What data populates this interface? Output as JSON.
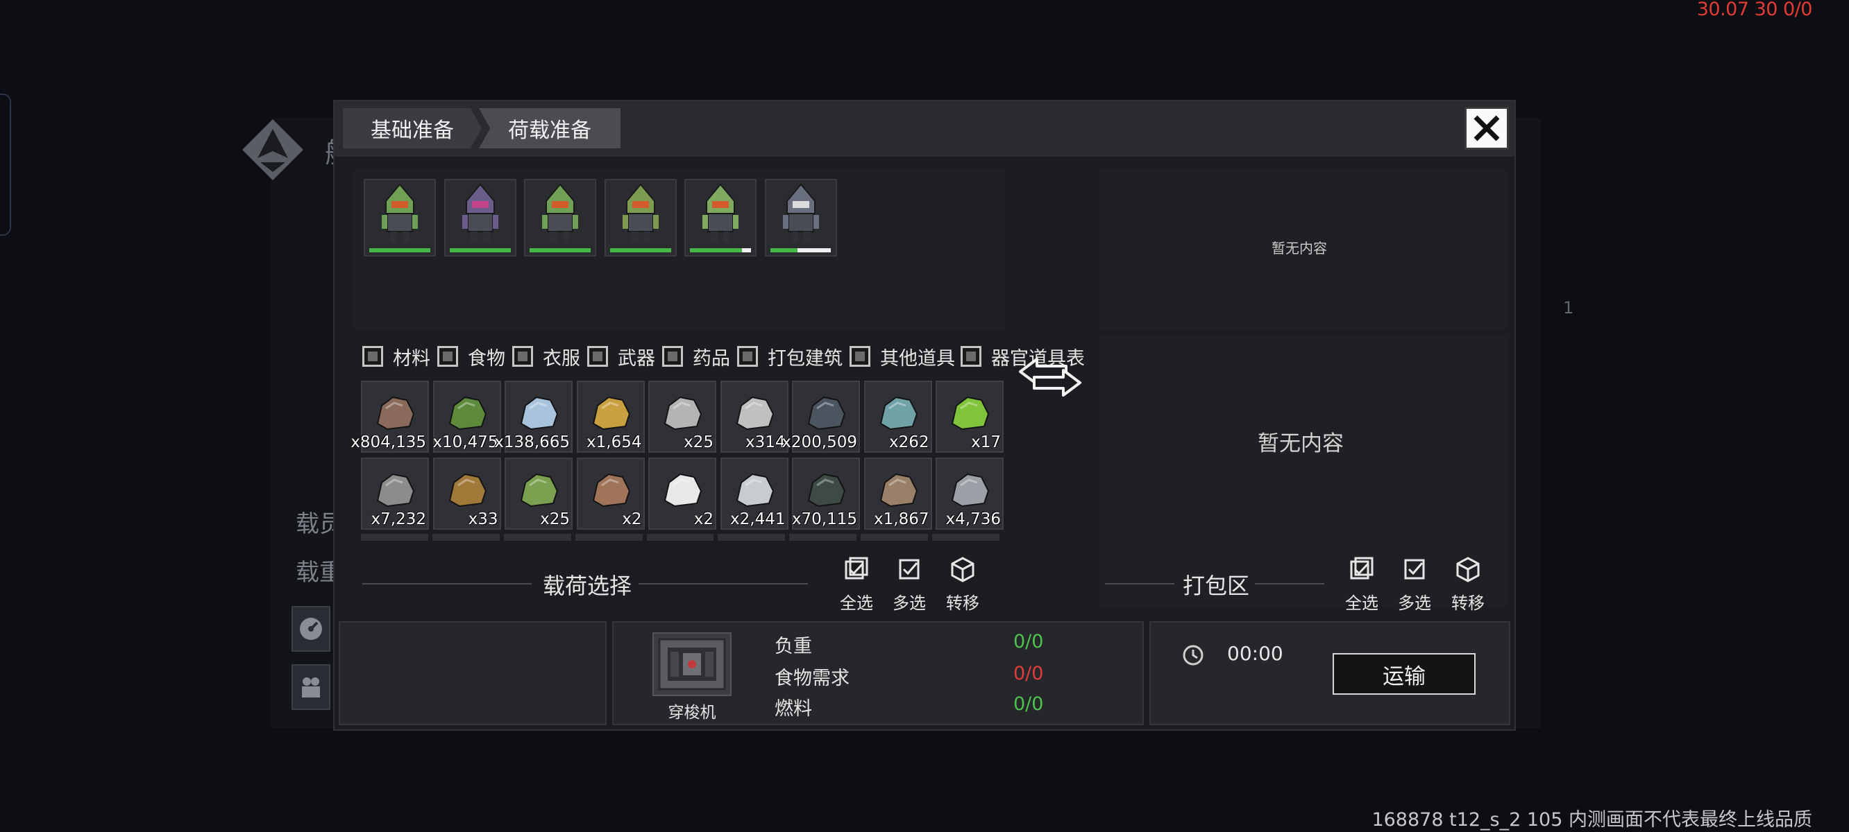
{
  "debug": {
    "fps": "30.07 30 0/0",
    "version": "168878 t12_s_2 105 内测画面不代表最终上线品质"
  },
  "background": {
    "title": "舰",
    "label_crew": "载员",
    "label_load": "载重",
    "right_tag": "1"
  },
  "tabs": [
    {
      "label": "基础准备"
    },
    {
      "label": "荷载准备"
    }
  ],
  "crew": [
    {
      "hp": 1.0,
      "helmet": "#6fa055",
      "visor": "#d35a2a"
    },
    {
      "hp": 1.0,
      "helmet": "#6a5d8c",
      "visor": "#c2438a"
    },
    {
      "hp": 1.0,
      "helmet": "#6fa055",
      "visor": "#d35a2a"
    },
    {
      "hp": 1.0,
      "helmet": "#7e9b52",
      "visor": "#d35a2a"
    },
    {
      "hp": 0.85,
      "helmet": "#7faa60",
      "visor": "#d35a2a"
    },
    {
      "hp": 0.45,
      "helmet": "#6a6f80",
      "visor": "#dcdcdc"
    }
  ],
  "categories": [
    {
      "label": "材料"
    },
    {
      "label": "食物"
    },
    {
      "label": "衣服"
    },
    {
      "label": "武器"
    },
    {
      "label": "药品"
    },
    {
      "label": "打包建筑"
    },
    {
      "label": "其他道具"
    },
    {
      "label": "器官道具表"
    }
  ],
  "items": [
    {
      "count": "x804,135",
      "icon": "ore-rock-icon",
      "color": "#8a6a5a"
    },
    {
      "count": "x10,475",
      "icon": "moss-rock-icon",
      "color": "#5c8a3a"
    },
    {
      "count": "x138,665",
      "icon": "crystal-cluster-icon",
      "color": "#a8c4dc"
    },
    {
      "count": "x1,654",
      "icon": "gold-ore-icon",
      "color": "#c9a040"
    },
    {
      "count": "x25",
      "icon": "rail-bundle-icon",
      "color": "#b4b4b4"
    },
    {
      "count": "x314",
      "icon": "machine-parts-icon",
      "color": "#c0c0c0"
    },
    {
      "count": "x200,509",
      "icon": "dark-ore-icon",
      "color": "#4a5560"
    },
    {
      "count": "x262",
      "icon": "circuit-board-icon",
      "color": "#6fa3a8"
    },
    {
      "count": "x17",
      "icon": "green-potion-icon",
      "color": "#7fc43a"
    },
    {
      "count": "x7,232",
      "icon": "gravel-icon",
      "color": "#8c8c8c"
    },
    {
      "count": "x33",
      "icon": "crate-icon",
      "color": "#a07838"
    },
    {
      "count": "x25",
      "icon": "plant-crate-icon",
      "color": "#7aa050"
    },
    {
      "count": "x2",
      "icon": "meat-chunk-icon",
      "color": "#a07458"
    },
    {
      "count": "x2",
      "icon": "medkit-icon",
      "color": "#e8e8e8"
    },
    {
      "count": "x2,441",
      "icon": "silver-ore-icon",
      "color": "#c8ccd0"
    },
    {
      "count": "x70,115",
      "icon": "steel-plates-icon",
      "color": "#3e4a44"
    },
    {
      "count": "x1,867",
      "icon": "copper-coil-icon",
      "color": "#9a8068"
    },
    {
      "count": "x4,736",
      "icon": "metal-sheet-icon",
      "color": "#9aa0a6"
    }
  ],
  "right_panel": {
    "empty_top": "暂无内容",
    "empty_bottom": "暂无内容"
  },
  "left_section": {
    "title": "载荷选择",
    "select_all": "全选",
    "multi_select": "多选",
    "transfer": "转移"
  },
  "right_section": {
    "title": "打包区",
    "select_all": "全选",
    "multi_select": "多选",
    "transfer": "转移"
  },
  "bottom": {
    "ship_name": "穿梭机",
    "stats": [
      {
        "label": "负重",
        "value": "0/0",
        "color": "#4ec24e"
      },
      {
        "label": "食物需求",
        "value": "0/0",
        "color": "#e03a3a"
      },
      {
        "label": "燃料",
        "value": "0/0",
        "color": "#4ec24e"
      }
    ],
    "timer": "00:00",
    "transport_label": "运输"
  }
}
